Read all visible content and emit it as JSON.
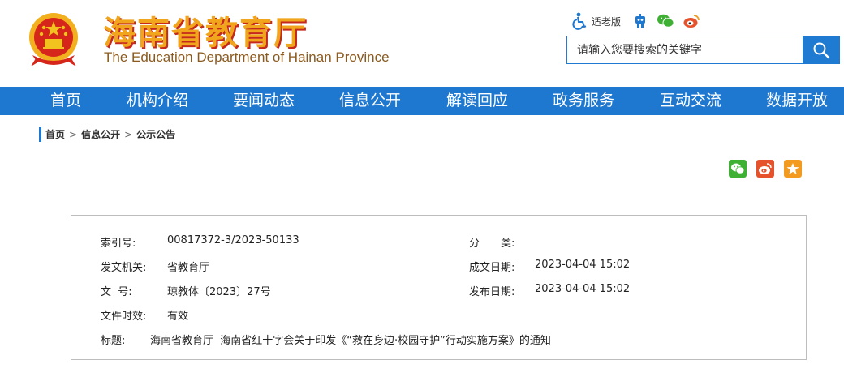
{
  "header": {
    "site_name_cn": "海南省教育厅",
    "site_name_en": "The Education Department of Hainan Province",
    "elder_mode_label": "适老版",
    "search_placeholder": "请输入您要搜索的关键字"
  },
  "icons": {
    "emblem": "national-emblem",
    "accessibility": "accessibility-icon",
    "robot": "robot-icon",
    "wechat": "wechat-icon",
    "weibo": "weibo-icon",
    "search": "search-icon",
    "favorite": "star-icon"
  },
  "nav": {
    "items": [
      "首页",
      "机构介绍",
      "要闻动态",
      "信息公开",
      "解读回应",
      "政务服务",
      "互动交流",
      "数据开放"
    ]
  },
  "breadcrumb": [
    "首页",
    "信息公开",
    "公示公告"
  ],
  "document_meta": {
    "index_label": "索引号:",
    "index_value": "00817372-3/2023-50133",
    "category_label": "分　　类:",
    "category_value": "",
    "issuer_label": "发文机关:",
    "issuer_value": "省教育厅",
    "created_label": "成文日期:",
    "created_value": "2023-04-04 15:02",
    "doc_no_label": "文  号:",
    "doc_no_value": "琼教体〔2023〕27号",
    "published_label": "发布日期:",
    "published_value": "2023-04-04 15:02",
    "validity_label": "文件时效:",
    "validity_value": "有效",
    "title_label": "标题:",
    "title_value": "海南省教育厅  海南省红十字会关于印发《“救在身边·校园守护”行动实施方案》的通知"
  },
  "colors": {
    "brand_blue": "#1f78cf",
    "title_gold": "#f0a51c",
    "title_red": "#c5281c",
    "wechat_green": "#3eb135",
    "weibo_red": "#e6522c",
    "favorite_orange": "#f29b1e"
  }
}
